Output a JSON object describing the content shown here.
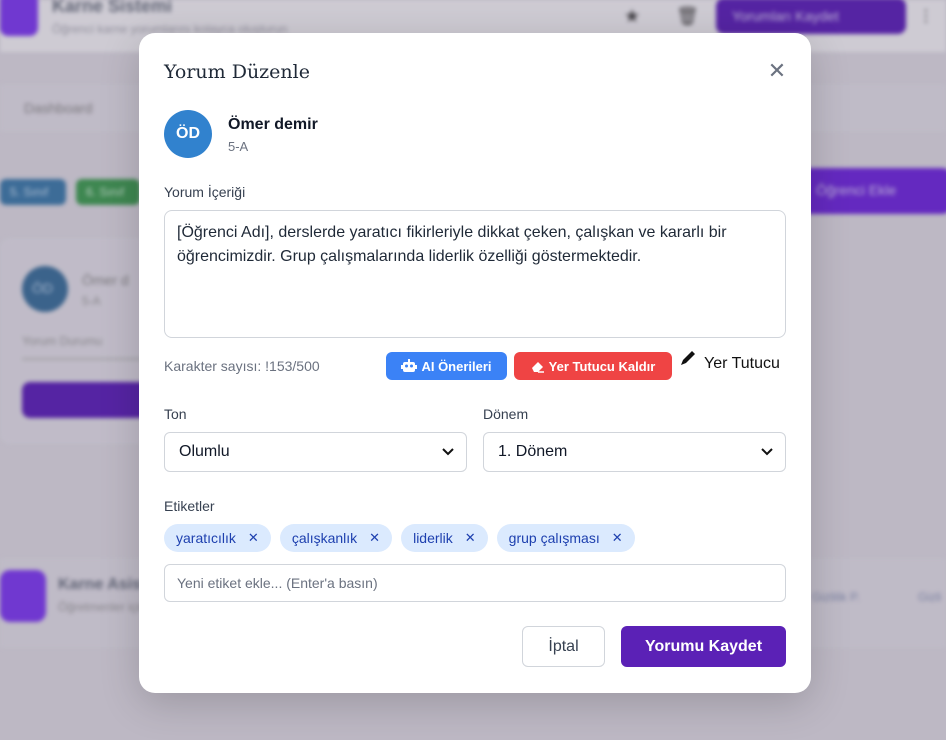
{
  "background": {
    "app_title": "Karne Sistemi",
    "app_subtitle": "Öğrenci karne yorumlarını kolayca oluşturun",
    "primary_action": "Yorumları Kaydet",
    "breadcrumb": "Dashboard",
    "chip_1": "5. Sınıf",
    "chip_2": "6. Sınıf",
    "add_button": "Öğrenci Ekle",
    "card_avatar": "ÖD",
    "card_name": "Ömer d",
    "card_class": "5-A",
    "card_meta": "Yorum Durumu",
    "footer_title": "Karne Asistanı",
    "footer_subtitle": "Öğretmenler için",
    "footer_link_1": "Gizlilik P.",
    "footer_link_2": "Gizli"
  },
  "modal": {
    "title": "Yorum Düzenle",
    "close_icon": "close-icon",
    "student": {
      "initials": "ÖD",
      "name": "Ömer demir",
      "class": "5-A"
    },
    "comment_label": "Yorum İçeriği",
    "comment_text": "[Öğrenci Adı], derslerde yaratıcı fikirleriyle dikkat çeken, çalışkan ve kararlı bir öğrencimizdir. Grup çalışmalarında liderlik özelliği göstermektedir.",
    "char_count": "Karakter sayısı: !153/500",
    "ai_button": "AI Önerileri",
    "remove_placeholder_button": "Yer Tutucu Kaldır",
    "placeholder_label": "Yer Tutucu",
    "tone_label": "Ton",
    "tone_value": "Olumlu",
    "term_label": "Dönem",
    "term_value": "1. Dönem",
    "tags_label": "Etiketler",
    "tags": [
      "yaratıcılık",
      "çalışkanlık",
      "liderlik",
      "grup çalışması"
    ],
    "tag_input_placeholder": "Yeni etiket ekle... (Enter'a basın)",
    "cancel_button": "İptal",
    "save_button": "Yorumu Kaydet"
  },
  "colors": {
    "primary": "#5b21b6",
    "ai_button": "#3b82f6",
    "remove_button": "#ef4444",
    "avatar": "#3182ce",
    "tag_bg": "#dbeafe",
    "tag_text": "#1e40af"
  }
}
